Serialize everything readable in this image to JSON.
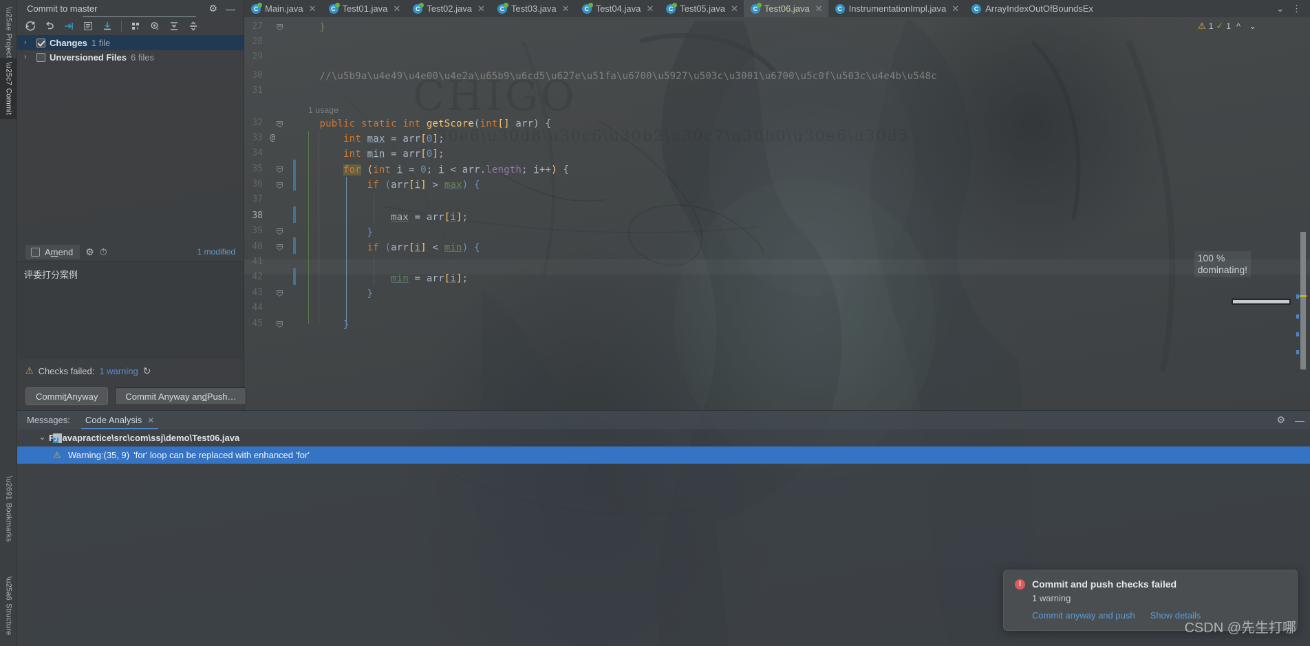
{
  "rail": {
    "items": [
      {
        "label": "Project",
        "icon": "folder-icon",
        "active": false
      },
      {
        "label": "Commit",
        "icon": "commit-icon",
        "active": true
      },
      {
        "label": "Bookmarks",
        "icon": "bookmark-icon",
        "active": false
      },
      {
        "label": "Structure",
        "icon": "structure-icon",
        "active": false
      }
    ]
  },
  "commit_panel": {
    "title": "Commit to master",
    "settings_icon": "gear-icon",
    "minimize_icon": "minimize-icon",
    "toolbar": [
      {
        "name": "refresh-changes-icon",
        "glyph": "↻"
      },
      {
        "name": "rollback-icon",
        "glyph": "↩"
      },
      {
        "name": "shelve-silently-icon",
        "glyph": "⇥"
      },
      {
        "name": "diff-icon",
        "glyph": "▤"
      },
      {
        "name": "update-project-icon",
        "glyph": "⤓"
      },
      {
        "name": "group-by-icon",
        "glyph": "∷"
      },
      {
        "name": "preview-diff-icon",
        "glyph": "◉"
      },
      {
        "name": "expand-all-icon",
        "glyph": "⇲"
      },
      {
        "name": "collapse-all-icon",
        "glyph": "⇱"
      }
    ],
    "tree": [
      {
        "label": "Changes",
        "count": "1 file",
        "checked": true,
        "selected": true,
        "arrow": "›"
      },
      {
        "label": "Unversioned Files",
        "count": "6 files",
        "checked": false,
        "selected": false,
        "arrow": "›"
      }
    ],
    "amend": {
      "label_pre": "A",
      "label_underlined": "m",
      "label_post": "end",
      "checked": false
    },
    "amend_icons": [
      {
        "name": "commit-options-gear-icon",
        "glyph": "⚙"
      },
      {
        "name": "commit-history-clock-icon",
        "glyph": "◴"
      }
    ],
    "modified_text": "1 modified",
    "commit_message": "评委打分案例",
    "checks": {
      "warning_icon": "warning-triangle-icon",
      "text": "Checks failed: ",
      "link": "1 warning",
      "rerun_icon": "rerun-icon"
    },
    "buttons": [
      {
        "name": "commit-anyway-button",
        "pre": "Commi",
        "u": "t",
        "post": " Anyway"
      },
      {
        "name": "commit-anyway-and-push-button",
        "pre": "Commit Anyway an",
        "u": "d",
        "post": " Push…"
      }
    ]
  },
  "tabs": [
    {
      "label": "Main.java",
      "active": false,
      "modified": true
    },
    {
      "label": "Test01.java",
      "active": false,
      "modified": true
    },
    {
      "label": "Test02.java",
      "active": false,
      "modified": true
    },
    {
      "label": "Test03.java",
      "active": false,
      "modified": true
    },
    {
      "label": "Test04.java",
      "active": false,
      "modified": true
    },
    {
      "label": "Test05.java",
      "active": false,
      "modified": true
    },
    {
      "label": "Test06.java",
      "active": true,
      "modified": true
    },
    {
      "label": "InstrumentationImpl.java",
      "active": false,
      "modified": false
    },
    {
      "label": "ArrayIndexOutOfBoundsEx",
      "active": false,
      "modified": false
    }
  ],
  "tabbar_right": [
    {
      "name": "tab-list-chevron-icon",
      "glyph": "⌄"
    },
    {
      "name": "tab-more-options-icon",
      "glyph": "⋮"
    }
  ],
  "editor": {
    "inspections": {
      "warning_icon": "warning-triangle-icon",
      "warning_count": "1",
      "ok_icon": "inspection-ok-icon",
      "ok_count": "1",
      "prev_icon": "⌃",
      "next_icon": "⌄"
    },
    "first_line": 27,
    "lines": [
      {
        "n": 27,
        "text": "    }",
        "tokens": [
          {
            "t": "    ",
            "c": "k-txt"
          },
          {
            "t": "}",
            "c": "k-grn"
          }
        ]
      },
      {
        "n": 28,
        "text": ""
      },
      {
        "n": 29,
        "text": ""
      },
      {
        "n": 30,
        "text": "    //定义一个方法找出最大值、最小值之和"
      },
      {
        "n": 31,
        "text": ""
      },
      {
        "n": 32,
        "text": "    public static int getScore(int[] arr) {"
      },
      {
        "n": 33,
        "text": "        int max = arr[0];"
      },
      {
        "n": 34,
        "text": "        int min = arr[0];"
      },
      {
        "n": 35,
        "text": "        for (int i = 0; i < arr.length; i++) {"
      },
      {
        "n": 36,
        "text": "            if (arr[i] > max) {"
      },
      {
        "n": 37,
        "text": ""
      },
      {
        "n": 38,
        "text": "                max = arr[i];"
      },
      {
        "n": 39,
        "text": "            }"
      },
      {
        "n": 40,
        "text": "            if (arr[i] < min) {"
      },
      {
        "n": 41,
        "text": ""
      },
      {
        "n": 42,
        "text": "                min = arr[i];"
      },
      {
        "n": 43,
        "text": "            }"
      },
      {
        "n": 44,
        "text": ""
      },
      {
        "n": 45,
        "text": "        }"
      }
    ],
    "usage_hint": "1 usage",
    "at_marker": "@",
    "current_line": 38,
    "wallpaper_text": {
      "line1": "100 %",
      "line2": "dominating!"
    }
  },
  "messages_window": {
    "label": "Messages:",
    "tab": "Code Analysis",
    "tab_close_icon": "close-icon",
    "settings_icon": "gear-icon",
    "minimize_icon": "minimize-icon",
    "file_row": {
      "arrow": "⌄",
      "path": "F:\\javapractice\\src\\com\\ssj\\demo\\Test06.java",
      "icon": "java-file-icon"
    },
    "warning_row": {
      "icon": "warning-triangle-icon",
      "prefix": "Warning:(35, 9)",
      "text": "'for' loop can be replaced with enhanced 'for'"
    }
  },
  "notification": {
    "icon": "error-circle-icon",
    "title": "Commit and push checks failed",
    "subtitle": "1 warning",
    "actions": [
      {
        "name": "commit-anyway-and-push-link",
        "label": "Commit anyway and push"
      },
      {
        "name": "show-details-link",
        "label": "Show details"
      }
    ]
  },
  "watermark": "CSDN @先生打哪",
  "colors": {
    "accent": "#3573c4",
    "warning": "#f0a732",
    "error": "#db5c5c",
    "link": "#5b9bd8",
    "selection": "#1f3a52"
  }
}
